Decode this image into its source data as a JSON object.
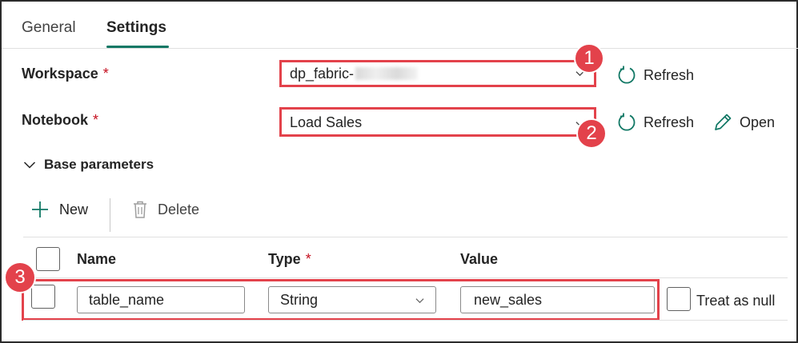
{
  "tabs": [
    {
      "label": "General",
      "active": false
    },
    {
      "label": "Settings",
      "active": true
    }
  ],
  "workspace": {
    "label": "Workspace",
    "required_mark": "*",
    "value": "dp_fabric-",
    "refresh_label": "Refresh"
  },
  "notebook": {
    "label": "Notebook",
    "required_mark": "*",
    "value": "Load Sales",
    "refresh_label": "Refresh",
    "open_label": "Open"
  },
  "callouts": [
    "1",
    "2",
    "3"
  ],
  "base_parameters": {
    "title": "Base parameters",
    "toolbar": {
      "new_label": "New",
      "delete_label": "Delete"
    },
    "columns": {
      "name": "Name",
      "type": "Type",
      "type_required": "*",
      "value": "Value"
    },
    "rows": [
      {
        "name": "table_name",
        "type": "String",
        "value": "new_sales",
        "treat_as_null_label": "Treat as null"
      }
    ]
  },
  "colors": {
    "accent": "#117865",
    "highlight": "#e3424b",
    "required": "#c50f1f"
  },
  "icons": {
    "refresh": "refresh-icon",
    "open": "pencil-icon",
    "new": "plus-icon",
    "delete": "trash-icon",
    "dropdown": "chevron-down-icon",
    "collapse": "chevron-down-icon"
  }
}
